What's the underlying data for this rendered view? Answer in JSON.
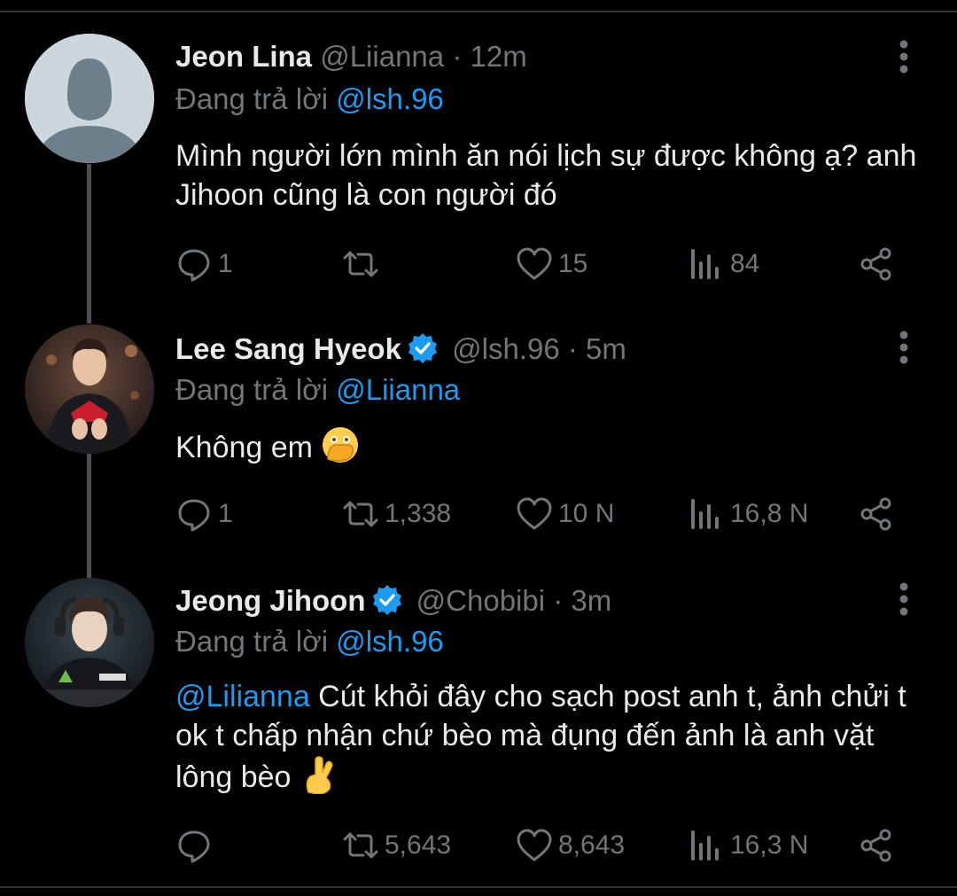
{
  "colors": {
    "background": "#000000",
    "text": "#e7e9ea",
    "muted": "#71767b",
    "accent": "#1d9bf0"
  },
  "tweets": [
    {
      "name": "Jeon Lina",
      "handle": "@Liianna",
      "separator": "·",
      "time": "12m",
      "verified": false,
      "reply_prefix": "Đang trả lời",
      "reply_to": "@lsh.96",
      "text": "Mình người lớn mình ăn nói lịch sự được không ạ? anh Jihoon cũng là con người đó",
      "stats": {
        "replies": "1",
        "retweets": "",
        "likes": "15",
        "views": "84"
      },
      "icons": [
        "reply-icon",
        "retweet-icon",
        "like-icon",
        "views-icon",
        "share-icon",
        "more-icon"
      ]
    },
    {
      "name": "Lee Sang Hyeok",
      "handle": "@lsh.96",
      "separator": "·",
      "time": "5m",
      "verified": true,
      "reply_prefix": "Đang trả lời",
      "reply_to": "@Liianna",
      "text": "Không em",
      "emoji": "face-with-open-eyes-and-hand-over-mouth",
      "stats": {
        "replies": "1",
        "retweets": "1,338",
        "likes": "10 N",
        "views": "16,8 N"
      }
    },
    {
      "name": "Jeong Jihoon",
      "handle": "@Chobibi",
      "separator": "·",
      "time": "3m",
      "verified": true,
      "reply_prefix": "Đang trả lời",
      "reply_to": "@lsh.96",
      "text_mention": "@Lilianna",
      "text": " Cút khỏi đây cho sạch post anh t, ảnh chửi t ok t chấp nhận chứ bèo mà đụng đến ảnh là anh vặt lông bèo",
      "emoji": "crossed-fingers",
      "stats": {
        "replies": "",
        "retweets": "5,643",
        "likes": "8,643",
        "views": "16,3 N"
      }
    }
  ]
}
